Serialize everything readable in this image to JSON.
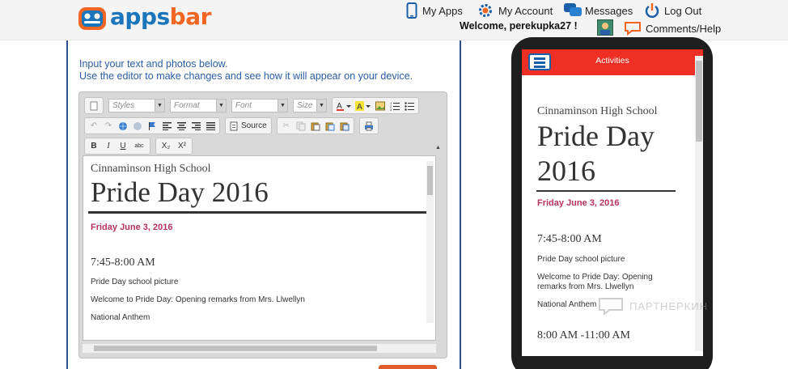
{
  "brand": {
    "logo_apps": "apps",
    "logo_bar": "bar",
    "blue": "#1b75bb",
    "orange": "#f26522"
  },
  "nav": {
    "my_apps": "My Apps",
    "my_account": "My Account",
    "messages": "Messages",
    "log_out": "Log Out",
    "welcome": "Welcome, perekupka27 !",
    "comments_help": "Comments/Help"
  },
  "editor": {
    "intro_line1": "Input your text and photos below.",
    "intro_line2": "Use the editor to make changes and see how it will appear on your device.",
    "toolbar": {
      "styles": "Styles",
      "format": "Format",
      "font": "Font",
      "size": "Size",
      "source": "Source",
      "bold": "B",
      "italic": "I",
      "underline": "U",
      "strike": "abc",
      "subscript": "X₂",
      "superscript": "X²"
    },
    "content": {
      "school": "Cinnaminson High School",
      "title": "Pride Day 2016",
      "date": "Friday June 3, 2016",
      "time1": "7:45-8:00 AM",
      "item1": "Pride Day school picture",
      "item2": "Welcome to Pride Day: Opening remarks from Mrs. Llwellyn",
      "item3": "National Anthem"
    }
  },
  "preview": {
    "appbar_title": "Activities",
    "appbar_color": "#ef2f24",
    "school": "Cinnaminson High School",
    "title": "Pride Day 2016",
    "date": "Friday June 3, 2016",
    "time1": "7:45-8:00 AM",
    "item1": "Pride Day school picture",
    "item2": "Welcome to Pride Day: Opening remarks from Mrs. Llwellyn",
    "item3": "National Anthem",
    "time2": "8:00 AM -11:00 AM"
  },
  "watermark": "ПАРТНЕРКИН",
  "accent_date_color": "#b5335c"
}
